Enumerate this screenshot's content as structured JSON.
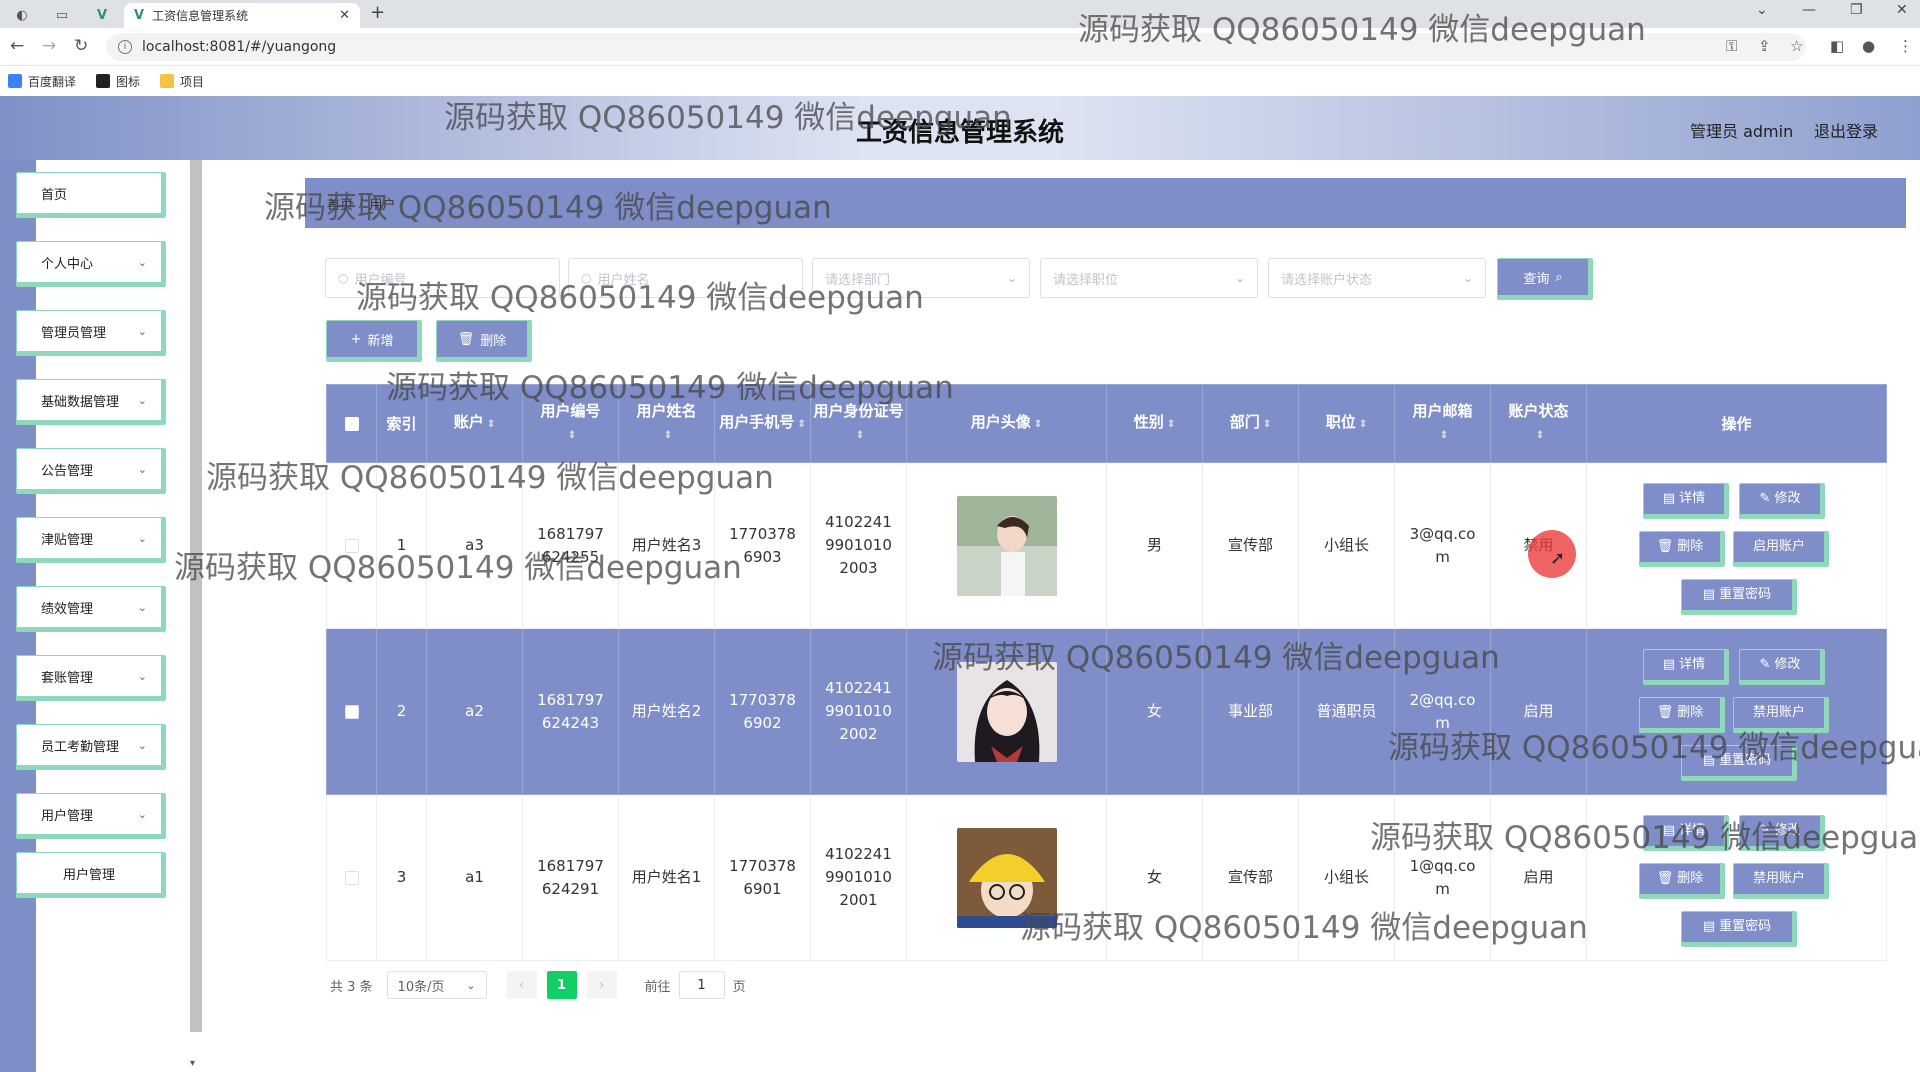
{
  "browser": {
    "tab_title": "工资信息管理系统",
    "url": "localhost:8081/#/yuangong",
    "bookmarks": [
      "百度翻译",
      "图标",
      "项目"
    ]
  },
  "header": {
    "title": "工资信息管理系统",
    "admin": "管理员 admin",
    "logout": "退出登录"
  },
  "sidebar": {
    "items": [
      {
        "label": "首页"
      },
      {
        "label": "个人中心"
      },
      {
        "label": "管理员管理"
      },
      {
        "label": "基础数据管理"
      },
      {
        "label": "公告管理"
      },
      {
        "label": "津贴管理"
      },
      {
        "label": "绩效管理"
      },
      {
        "label": "套账管理"
      },
      {
        "label": "员工考勤管理"
      },
      {
        "label": "用户管理"
      }
    ],
    "sub_item": "用户管理"
  },
  "breadcrumb": {
    "home": "首页",
    "sep": "/",
    "current": "用户"
  },
  "filters": {
    "user_no_placeholder": "用户编号",
    "user_name_placeholder": "用户姓名",
    "dept_placeholder": "请选择部门",
    "position_placeholder": "请选择职位",
    "status_placeholder": "请选择账户状态",
    "query": "查询"
  },
  "actions": {
    "add": "新增",
    "delete": "删除"
  },
  "table": {
    "headers": {
      "index": "索引",
      "account": "账户",
      "user_no": "用户编号",
      "user_name": "用户姓名",
      "phone": "用户手机号",
      "id_card": "用户身份证号",
      "avatar": "用户头像",
      "gender": "性别",
      "dept": "部门",
      "position": "职位",
      "email": "用户邮箱",
      "status": "账户状态",
      "ops": "操作"
    },
    "rows": [
      {
        "index": "1",
        "account": "a3",
        "user_no": "1681797624255",
        "user_name": "用户姓名3",
        "phone": "17703786903",
        "id_card": "410224199010102003",
        "gender": "男",
        "dept": "宣传部",
        "position": "小组长",
        "email": "3@qq.com",
        "status": "禁用",
        "toggle": "启用账户"
      },
      {
        "index": "2",
        "account": "a2",
        "user_no": "1681797624243",
        "user_name": "用户姓名2",
        "phone": "17703786902",
        "id_card": "410224199010102002",
        "gender": "女",
        "dept": "事业部",
        "position": "普通职员",
        "email": "2@qq.com",
        "status": "启用",
        "toggle": "禁用账户"
      },
      {
        "index": "3",
        "account": "a1",
        "user_no": "1681797624291",
        "user_name": "用户姓名1",
        "phone": "17703786901",
        "id_card": "410224199010102001",
        "gender": "女",
        "dept": "宣传部",
        "position": "小组长",
        "email": "1@qq.com",
        "status": "启用",
        "toggle": "禁用账户"
      }
    ],
    "op_labels": {
      "detail": "详情",
      "edit": "修改",
      "delete": "删除",
      "reset": "重置密码"
    }
  },
  "pagination": {
    "total": "共 3 条",
    "page_size": "10条/页",
    "current": "1",
    "goto_prefix": "前往",
    "goto_value": "1",
    "goto_suffix": "页"
  },
  "watermark": "源码获取 QQ86050149 微信deepguan",
  "colors": {
    "primary": "#7f8ec8",
    "accent_border": "#8fd8bb",
    "active_page": "#13ce66"
  }
}
